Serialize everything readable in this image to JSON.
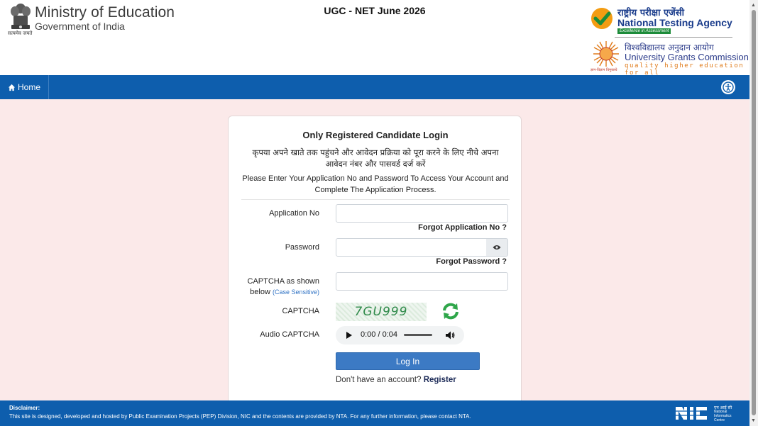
{
  "header": {
    "emblem_motto": "सत्यमेव जयते",
    "ministry_title": "Ministry of Education",
    "ministry_subtitle": "Government of India",
    "exam_title": "UGC - NET June 2026",
    "nta_hindi": "राष्ट्रीय परीक्षा एजेंसी",
    "nta_english": "National Testing Agency",
    "nta_tagline": "Excellence in Assessment",
    "ugc_hindi": "विश्वविद्यालय अनुदान आयोग",
    "ugc_english": "University Grants Commission",
    "ugc_tagline": "quality higher education for all",
    "ugc_small_text": "ज्ञान-विज्ञान विमुक्तये"
  },
  "navbar": {
    "home_label": "Home"
  },
  "login": {
    "title": "Only Registered Candidate Login",
    "hindi_instruction": "कृपया अपने खाते तक पहुंचने और आवेदन प्रक्रिया को पूरा करने के लिए नीचे अपना आवेदन नंबर और पासवर्ड दर्ज करें",
    "english_instruction": "Please Enter Your Application No and Password To Access Your Account and Complete The Application Process.",
    "application_no_label": "Application No",
    "application_no_value": "",
    "forgot_application_no": "Forgot Application No ?",
    "password_label": "Password",
    "password_value": "",
    "forgot_password": "Forgot Password ?",
    "captcha_input_label": "CAPTCHA as shown below",
    "captcha_case_note": "(Case Sensitive)",
    "captcha_input_value": "",
    "captcha_label": "CAPTCHA",
    "captcha_text": "7GU999",
    "audio_captcha_label": "Audio CAPTCHA",
    "audio_time": "0:00 / 0:04",
    "login_button": "Log In",
    "no_account_text": "Don't have an account?",
    "register_link": "Register"
  },
  "footer": {
    "disclaimer_title": "Disclaimer:",
    "disclaimer_text": "This site is designed, developed and hosted by Public Examination Projects (PEP) Division, NIC and the contents are provided by NTA. For any further information, please contact NTA.",
    "nic_hindi": "एन आई सी",
    "nic_english": "National Informatics Centre"
  },
  "colors": {
    "navbar": "#0e5ead",
    "page_background": "#fbe9e9",
    "login_button": "#3c7ac4",
    "nta_blue": "#1b3d8c",
    "nta_green": "#1d8c3a"
  }
}
